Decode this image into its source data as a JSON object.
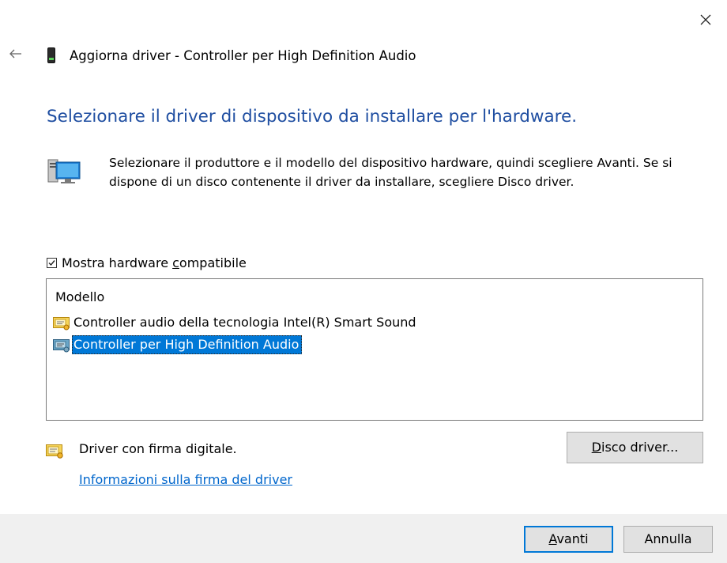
{
  "window": {
    "title": "Aggiorna driver - Controller per High Definition Audio"
  },
  "heading": "Selezionare il driver di dispositivo da installare per l'hardware.",
  "description": {
    "line1": "Selezionare il produttore e il modello del dispositivo hardware, quindi scegliere Avanti. Se si",
    "line2": "dispone di un disco contenente il driver da installare, scegliere Disco driver."
  },
  "compatible_checkbox": {
    "label_before": "Mostra hardware ",
    "label_key": "c",
    "label_after": "ompatibile",
    "checked": true
  },
  "model_list": {
    "header": "Modello",
    "items": [
      {
        "label": "Controller audio della tecnologia Intel(R) Smart Sound",
        "selected": false
      },
      {
        "label": "Controller per High Definition Audio",
        "selected": true
      }
    ]
  },
  "signature": {
    "text": "Driver con firma digitale.",
    "link": "Informazioni sulla firma del driver"
  },
  "buttons": {
    "disk_key": "D",
    "disk_rest": "isco driver...",
    "next_key": "A",
    "next_rest": "vanti",
    "cancel": "Annulla"
  },
  "colors": {
    "heading": "#1f4ea1",
    "selection": "#0078d7",
    "link": "#0066cc"
  },
  "icons": {
    "close": "close-icon",
    "back": "back-arrow-icon",
    "device": "device-icon",
    "computer": "computer-monitor-icon",
    "driver": "driver-certificate-icon"
  }
}
